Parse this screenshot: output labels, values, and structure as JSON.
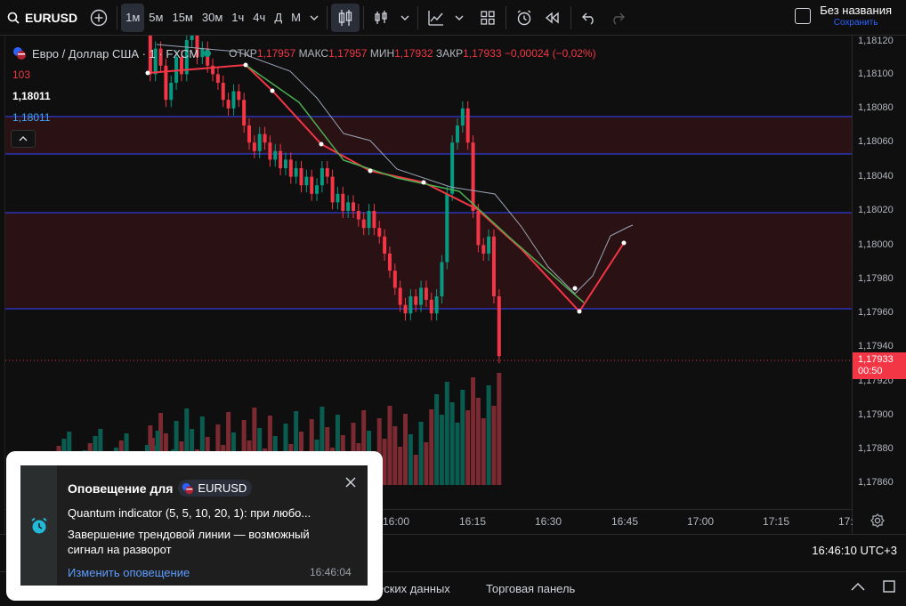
{
  "toolbar": {
    "symbol": "EURUSD",
    "timeframes": [
      "1м",
      "5м",
      "15м",
      "30м",
      "1ч",
      "4ч",
      "Д",
      "М"
    ],
    "active_timeframe": "1м",
    "layout_title": "Без названия",
    "layout_subtitle": "Сохранить"
  },
  "legend": {
    "name": "Евро / Доллар США · 1 · FXCM",
    "open_label": "ОТКР",
    "open": "1,17957",
    "high_label": "МАКС",
    "high": "1,17957",
    "low_label": "МИН",
    "low": "1,17932",
    "close_label": "ЗАКР",
    "close": "1,17933",
    "change": "−0,00024 (−0,02%)"
  },
  "side_labels": {
    "volume": "103",
    "price_a": "1,18011",
    "price_b": "1,18011"
  },
  "price_axis": {
    "ticks": [
      "1,18120",
      "1,18100",
      "1,18080",
      "1,18060",
      "1,18040",
      "1,18020",
      "1,18000",
      "1,17980",
      "1,17960",
      "1,17940",
      "1,17920",
      "1,17900",
      "1,17880",
      "1,17860"
    ],
    "last_price": "1,17933",
    "countdown": "00:50"
  },
  "time_axis": {
    "ticks": [
      "16:00",
      "16:15",
      "16:30",
      "16:45",
      "17:00",
      "17:15",
      "17:"
    ]
  },
  "status": {
    "clock": "16:46:10 UTC+3"
  },
  "bottom_tabs": [
    "еских данных",
    "Торговая панель"
  ],
  "notification": {
    "title": "Оповещение для",
    "symbol": "EURUSD",
    "line1": "Quantum indicator (5, 5, 10, 20, 1): при любо...",
    "line2": "Завершение трендовой линии — возможный сигнал на разворот",
    "link": "Изменить оповещение",
    "time": "16:46:04"
  },
  "colors": {
    "up": "#089981",
    "down": "#f23645",
    "zone": "#2a1214",
    "hline": "#2f3bd6",
    "accent": "#2962ff"
  }
}
